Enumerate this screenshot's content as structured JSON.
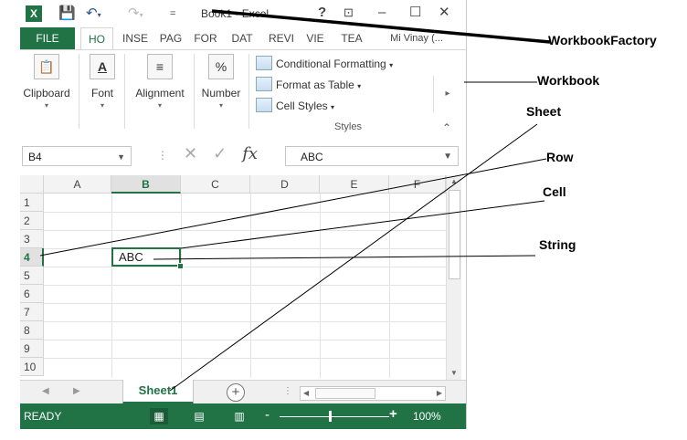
{
  "window": {
    "app_icon": "X",
    "title": "Book1 - Excel",
    "help": "?",
    "restore_ribbon": "⊡",
    "minimize": "–",
    "maximize": "☐",
    "close": "✕"
  },
  "tabs": [
    {
      "label": "FILE"
    },
    {
      "label": "HO"
    },
    {
      "label": "INSE"
    },
    {
      "label": "PAG"
    },
    {
      "label": "FOR"
    },
    {
      "label": "DAT"
    },
    {
      "label": "REVI"
    },
    {
      "label": "VIE"
    },
    {
      "label": "TEA"
    },
    {
      "label": "Mi Vinay (..."
    }
  ],
  "ribbon": {
    "clipboard": "Clipboard",
    "font": "Font",
    "alignment": "Alignment",
    "number": "Number",
    "conditional_formatting": "Conditional Formatting",
    "format_as_table": "Format as Table",
    "cell_styles": "Cell Styles",
    "styles_group": "Styles",
    "font_icon": "A",
    "number_icon": "%"
  },
  "formula_bar": {
    "name_box": "B4",
    "fx": "fx",
    "value": "ABC"
  },
  "grid": {
    "columns": [
      "A",
      "B",
      "C",
      "D",
      "E",
      "F"
    ],
    "rows": [
      "1",
      "2",
      "3",
      "4",
      "5",
      "6",
      "7",
      "8",
      "9",
      "10"
    ],
    "selected_cell_value": "ABC"
  },
  "sheets": {
    "active": "Sheet1",
    "add": "+"
  },
  "status": {
    "ready": "READY",
    "zoom_minus": "-",
    "zoom_plus": "+",
    "zoom": "100%"
  },
  "annotations": {
    "workbook_factory": "WorkbookFactory",
    "workbook": "Workbook",
    "sheet": "Sheet",
    "row": "Row",
    "cell": "Cell",
    "string": "String"
  },
  "colors": {
    "excel_green": "#217346",
    "status_dark": "#1a5c37"
  }
}
